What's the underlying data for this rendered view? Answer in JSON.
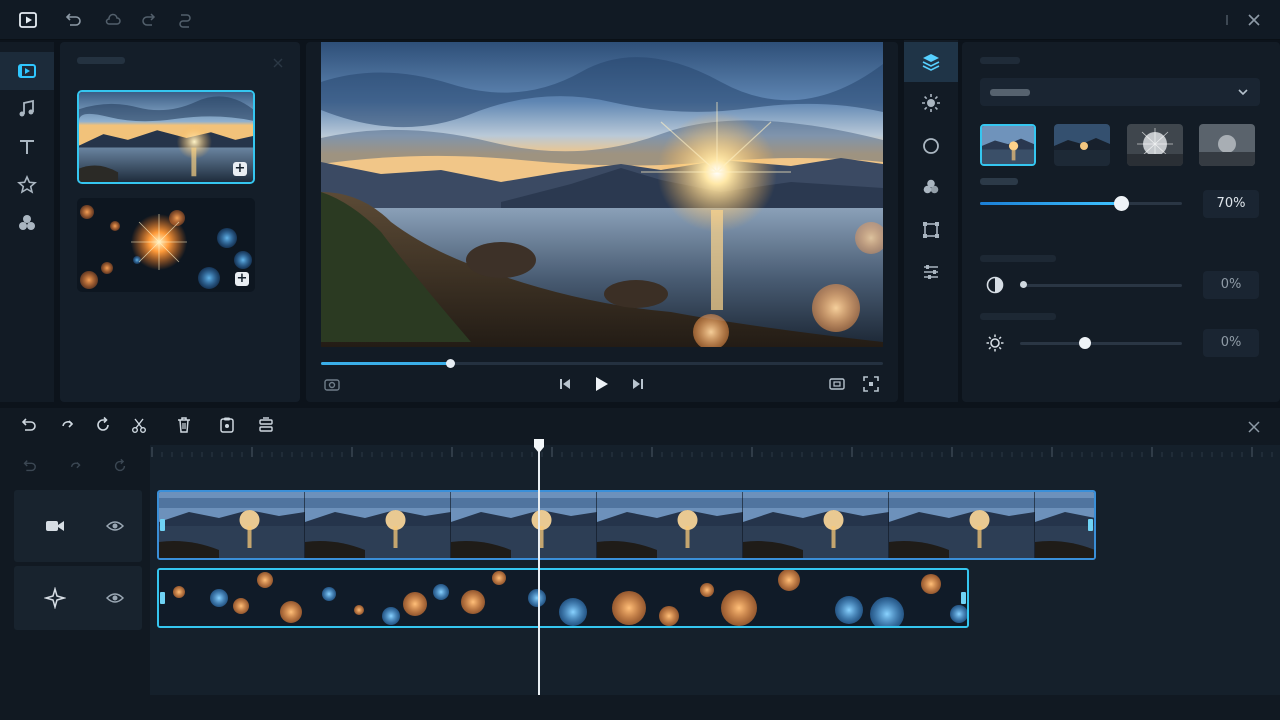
{
  "topbar": {
    "icons": [
      "play-logo-icon",
      "import-icon",
      "undo-cloud-icon",
      "redo-icon",
      "sync-icon",
      "more-vert-icon",
      "close-icon"
    ]
  },
  "left_rail": {
    "items": [
      {
        "icon": "video-icon",
        "active": true
      },
      {
        "icon": "music-icon",
        "active": false
      },
      {
        "icon": "text-icon",
        "active": false
      },
      {
        "icon": "star-icon",
        "active": false
      },
      {
        "icon": "effects-icon",
        "active": false
      }
    ]
  },
  "media_panel": {
    "items": [
      {
        "name": "sunset-lake-thumbnail",
        "selected": true
      },
      {
        "name": "bokeh-lights-thumbnail",
        "selected": false
      }
    ]
  },
  "preview": {
    "progress": 0.23
  },
  "properties": {
    "opacity_value": "70%",
    "opacity_level": 0.7,
    "contrast_value": "0%",
    "contrast_level": 0.0,
    "brightness_value": "0%",
    "brightness_level": 0.4
  },
  "timeline": {
    "playhead_fraction": 0.34
  },
  "colors": {
    "accent": "#35c6f0",
    "accent_blue": "#3a8fd8",
    "panel": "#141e29"
  }
}
